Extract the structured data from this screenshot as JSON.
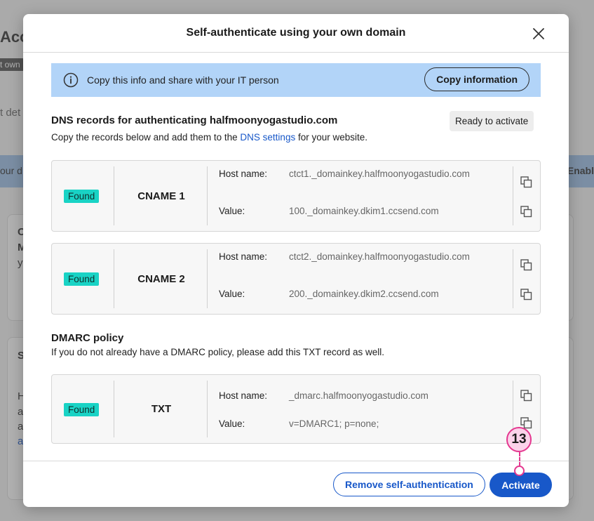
{
  "background": {
    "title": "Acco",
    "badge": "t own",
    "subtitle": "t det",
    "bar_text": "our d",
    "bar_action": "Enabl",
    "card_letters": [
      "C",
      "M",
      "y"
    ],
    "card2_letters": [
      "S",
      "H",
      "a",
      "a",
      "a"
    ]
  },
  "modal": {
    "title": "Self-authenticate using your own domain",
    "info_bar": {
      "text": "Copy this info and share with your IT person",
      "button": "Copy information"
    },
    "dns_section": {
      "title": "DNS records for authenticating halfmoonyogastudio.com",
      "desc_before": "Copy the records below and add them to the ",
      "desc_link": "DNS settings",
      "desc_after": " for your website.",
      "status_badge": "Ready to activate"
    },
    "records": [
      {
        "status": "Found",
        "type": "CNAME 1",
        "host_label": "Host name:",
        "host_value": "ctct1._domainkey.halfmoonyogastudio.com",
        "value_label": "Value:",
        "value": "100._domainkey.dkim1.ccsend.com"
      },
      {
        "status": "Found",
        "type": "CNAME 2",
        "host_label": "Host name:",
        "host_value": "ctct2._domainkey.halfmoonyogastudio.com",
        "value_label": "Value:",
        "value": "200._domainkey.dkim2.ccsend.com"
      }
    ],
    "dmarc_section": {
      "title": "DMARC policy",
      "desc": "If you do not already have a DMARC policy, please add this TXT record as well."
    },
    "dmarc_record": {
      "status": "Found",
      "type": "TXT",
      "host_label": "Host name:",
      "host_value": "_dmarc.halfmoonyogastudio.com",
      "value_label": "Value:",
      "value": "v=DMARC1; p=none;"
    },
    "footer": {
      "remove_button": "Remove self-authentication",
      "activate_button": "Activate"
    }
  },
  "step_marker": "13",
  "colors": {
    "accent": "#1858c9",
    "found_badge": "#19d3c5",
    "info_bar": "#b2d4f8",
    "marker": "#e4378f"
  }
}
